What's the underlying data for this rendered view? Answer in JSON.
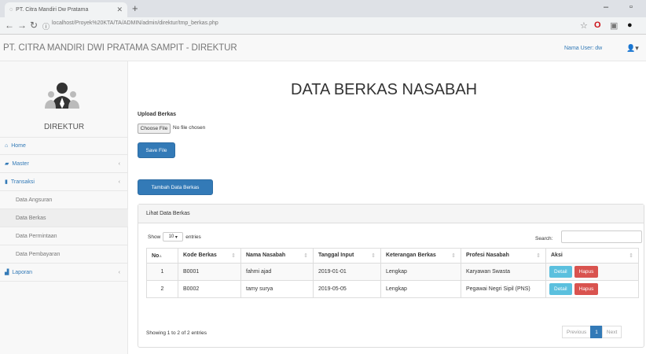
{
  "browser": {
    "tab_title": "PT. Citra Mandiri Dw Pratama",
    "url": "localhost/Proyek%20KTA/TA/ADMIN/admin/direktur/tmp_berkas.php",
    "url_prefix": "localhost"
  },
  "navbar": {
    "brand": "PT. CITRA MANDIRI DWI PRATAMA SAMPIT - DIREKTUR",
    "user": "Nama User: dw"
  },
  "sidebar": {
    "role": "DIREKTUR",
    "items": [
      {
        "label": "Home",
        "icon": "home-icon"
      },
      {
        "label": "Master",
        "icon": "folder-icon"
      },
      {
        "label": "Transaksi",
        "icon": "book-icon"
      },
      {
        "label": "Data Angsuran"
      },
      {
        "label": "Data Berkas"
      },
      {
        "label": "Data Permintaan"
      },
      {
        "label": "Data Pembayaran"
      },
      {
        "label": "Laporan",
        "icon": "chart-icon"
      }
    ]
  },
  "main": {
    "title": "DATA BERKAS NASABAH",
    "upload_label": "Upload Berkas",
    "choose_file": "Choose File",
    "no_file": "No file chosen",
    "save_button": "Save File",
    "add_button": "Tambah Data Berkas",
    "panel_heading": "Lihat Data Berkas",
    "show_label": "Show",
    "show_value": "10",
    "entries_label": "entries",
    "search_label": "Search:",
    "columns": [
      "No",
      "Kode Berkas",
      "Nama Nasabah",
      "Tanggal Input",
      "Keterangan Berkas",
      "Profesi Nasabah",
      "Aksi"
    ],
    "rows": [
      {
        "no": "1",
        "kode": "B0001",
        "nama": "fahmi ajad",
        "tanggal": "2019-01-01",
        "keterangan": "Lengkap",
        "profesi": "Karyawan Swasta"
      },
      {
        "no": "2",
        "kode": "B0002",
        "nama": "tamy surya",
        "tanggal": "2019-05-05",
        "keterangan": "Lengkap",
        "profesi": "Pegawai Negri Sipil (PNS)"
      }
    ],
    "detail_label": "Detail",
    "delete_label": "Hapus",
    "info": "Showing 1 to 2 of 2 entries",
    "pagination": {
      "prev": "Previous",
      "current": "1",
      "next": "Next"
    }
  },
  "colors": {
    "primary": "#337ab7",
    "info": "#5bc0de",
    "danger": "#d9534f"
  }
}
